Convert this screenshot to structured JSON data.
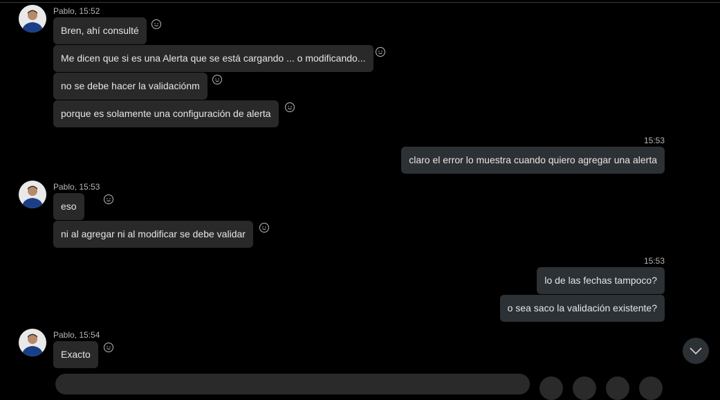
{
  "conversation": {
    "groups": [
      {
        "sender_meta": "Pablo, 15:52",
        "messages": [
          "Bren, ahí consulté",
          "Me dicen que si es una Alerta que se está cargando ... o modificando...",
          "no se debe hacer la validaciónm",
          "porque es solamente una configuración de alerta"
        ]
      },
      {
        "sender_meta": "15:53",
        "messages": [
          "claro el error lo muestra cuando quiero agregar una alerta"
        ]
      },
      {
        "sender_meta": "Pablo, 15:53",
        "messages": [
          "eso",
          "ni al agregar ni al modificar se debe validar"
        ]
      },
      {
        "sender_meta": "15:53",
        "messages": [
          "lo de las fechas tampoco?",
          "o sea saco la validación existente?"
        ]
      },
      {
        "sender_meta": "Pablo, 15:54",
        "messages": [
          "Exacto"
        ]
      }
    ]
  },
  "icons": {
    "reaction": "smiley-icon",
    "scroll": "chevron-down-icon"
  },
  "colors": {
    "background": "#000000",
    "bubble_other": "#292929",
    "bubble_me": "#2c3136",
    "meta_text": "#b8b8b8"
  }
}
